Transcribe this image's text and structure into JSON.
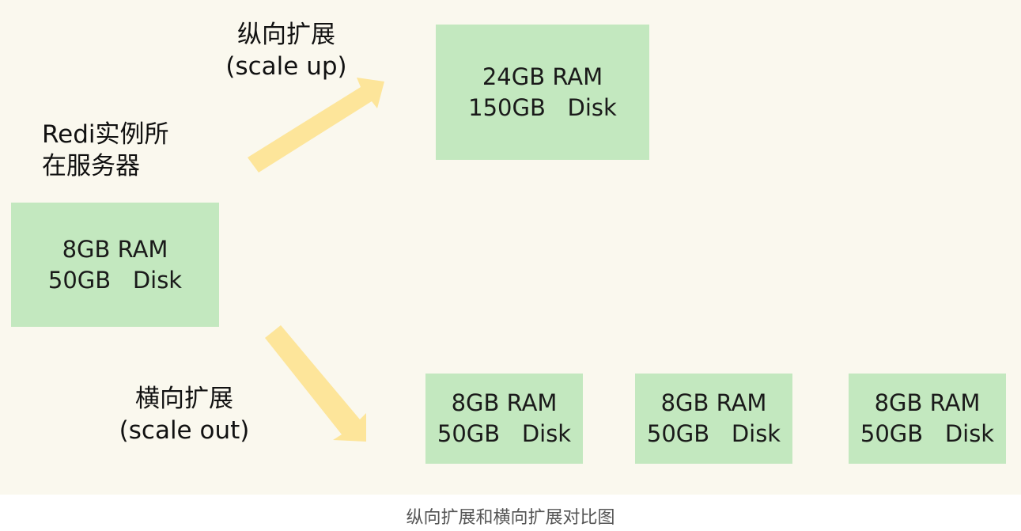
{
  "server_label": [
    "Redi实例所",
    "在服务器"
  ],
  "original_box": {
    "ram": "8GB RAM",
    "disk": "50GB   Disk"
  },
  "scale_up": {
    "label": "纵向扩展",
    "sublabel": "(scale up)",
    "box": {
      "ram": "24GB RAM",
      "disk": "150GB   Disk"
    }
  },
  "scale_out": {
    "label": "横向扩展",
    "sublabel": "(scale out)",
    "boxes": [
      {
        "ram": "8GB RAM",
        "disk": "50GB   Disk"
      },
      {
        "ram": "8GB RAM",
        "disk": "50GB   Disk"
      },
      {
        "ram": "8GB RAM",
        "disk": "50GB   Disk"
      }
    ]
  },
  "caption": "纵向扩展和横向扩展对比图",
  "colors": {
    "background": "#faf8ee",
    "box": "#c3e8bf",
    "arrow": "#fde59a"
  }
}
